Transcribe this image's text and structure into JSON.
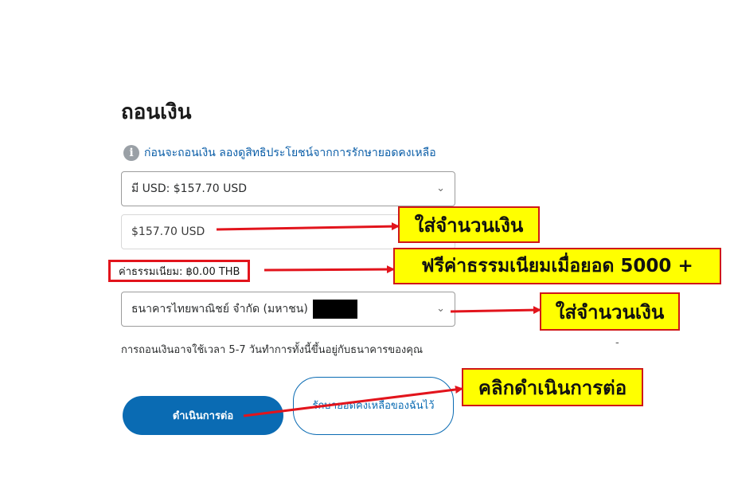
{
  "page": {
    "title": "ถอนเงิน",
    "info_text": "ก่อนจะถอนเงิน ลองดูสิทธิประโยชน์จากการรักษายอดคงเหลือ"
  },
  "balance_select": {
    "value": "มี USD: $157.70 USD"
  },
  "amount_field": {
    "value": "$157.70 USD"
  },
  "fee": {
    "label": "ค่าธรรมเนียม: ฿0.00 THB"
  },
  "bank_select": {
    "value": "ธนาคารไทยพาณิชย์ จำกัด (มหาชน)"
  },
  "note": {
    "text": "การถอนเงินอาจใช้เวลา 5-7 วันทำการทั้งนี้ขึ้นอยู่กับธนาคารของคุณ",
    "dash": "-"
  },
  "buttons": {
    "continue": "ดำเนินการต่อ",
    "keep_balance": "รักษายอดคงเหลือของฉันไว้"
  },
  "annotations": {
    "amount": "ใส่จำนวนเงิน",
    "fee": "ฟรีค่าธรรมเนียมเมื่อยอด 5000 +",
    "bank": "ใส่จำนวนเงิน",
    "continue": "คลิกดำเนินการต่อ"
  },
  "colors": {
    "primary": "#0a6bb3",
    "callout_bg": "#ffff00",
    "callout_border": "#d01818"
  },
  "icons": {
    "info": "info-icon",
    "chevron": "chevron-down-icon"
  }
}
